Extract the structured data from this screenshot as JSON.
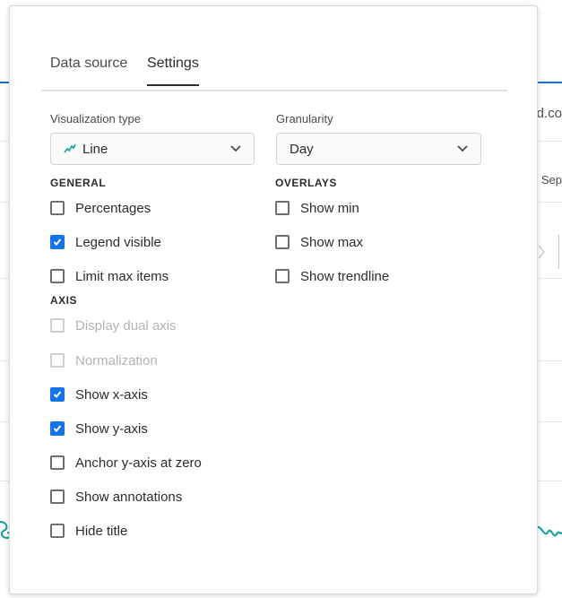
{
  "background": {
    "right_text": "d.co",
    "sep_text": "Sep"
  },
  "tabs": [
    {
      "label": "Data source",
      "active": false
    },
    {
      "label": "Settings",
      "active": true
    }
  ],
  "visualization_type": {
    "label": "Visualization type",
    "value": "Line",
    "icon": "line-chart-icon"
  },
  "granularity": {
    "label": "Granularity",
    "value": "Day"
  },
  "general": {
    "header": "GENERAL",
    "items": [
      {
        "label": "Percentages",
        "checked": false,
        "disabled": false
      },
      {
        "label": "Legend visible",
        "checked": true,
        "disabled": false
      },
      {
        "label": "Limit max items",
        "checked": false,
        "disabled": false
      }
    ]
  },
  "overlays": {
    "header": "OVERLAYS",
    "items": [
      {
        "label": "Show min",
        "checked": false,
        "disabled": false
      },
      {
        "label": "Show max",
        "checked": false,
        "disabled": false
      },
      {
        "label": "Show trendline",
        "checked": false,
        "disabled": false
      }
    ]
  },
  "axis": {
    "header": "AXIS",
    "items": [
      {
        "label": "Display dual axis",
        "checked": false,
        "disabled": true
      },
      {
        "label": "Normalization",
        "checked": false,
        "disabled": true
      },
      {
        "label": "Show x-axis",
        "checked": true,
        "disabled": false
      },
      {
        "label": "Show y-axis",
        "checked": true,
        "disabled": false
      },
      {
        "label": "Anchor y-axis at zero",
        "checked": false,
        "disabled": false
      },
      {
        "label": "Show annotations",
        "checked": false,
        "disabled": false
      },
      {
        "label": "Hide title",
        "checked": false,
        "disabled": false
      }
    ]
  },
  "colors": {
    "accent": "#1473e6",
    "teal_line": "#0d9ea0"
  }
}
